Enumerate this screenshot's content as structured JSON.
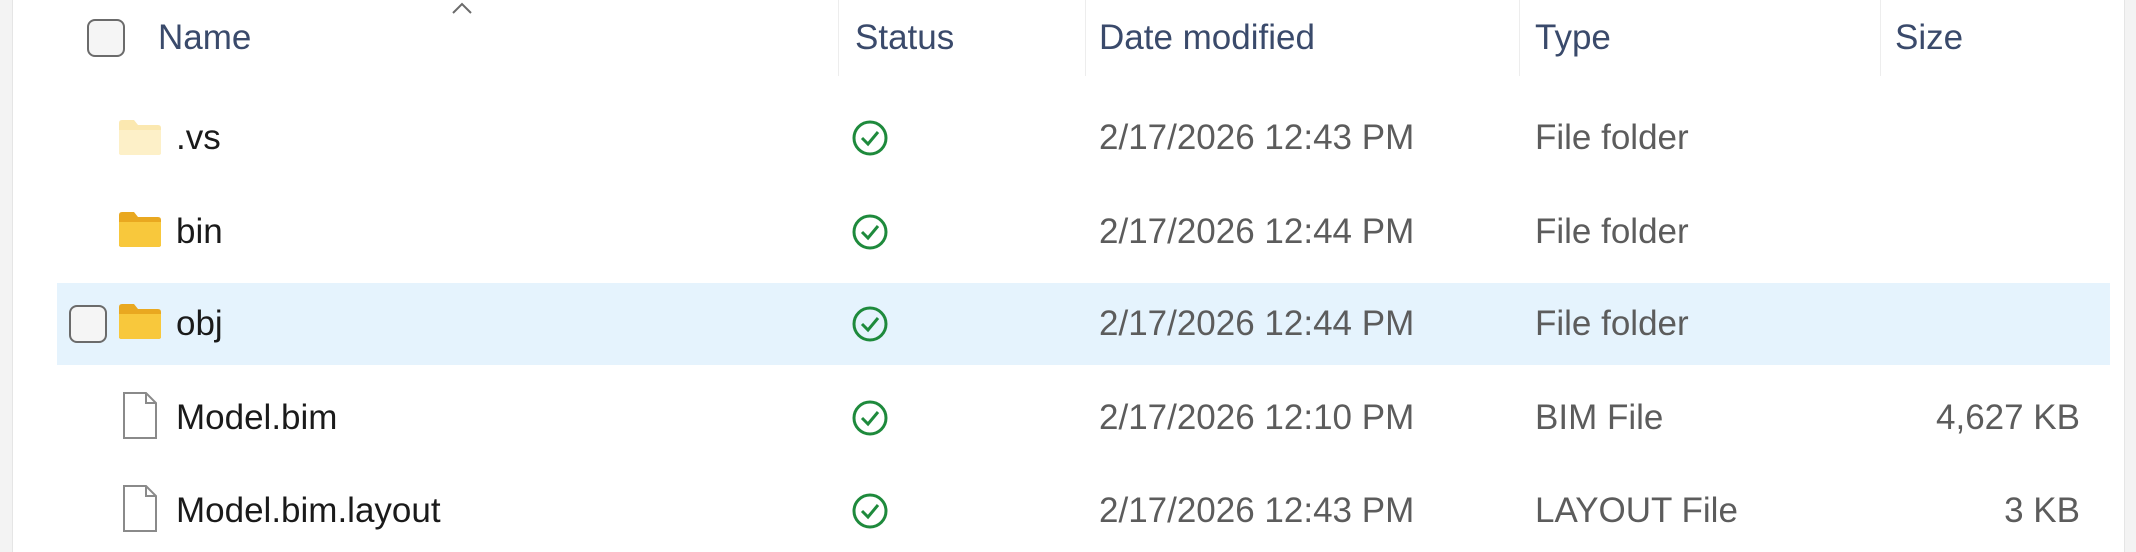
{
  "columns": {
    "name": "Name",
    "status": "Status",
    "date_modified": "Date modified",
    "type": "Type",
    "size": "Size"
  },
  "rows": [
    {
      "name": ".vs",
      "icon": "folder-icon-faded",
      "status": "synced",
      "date": "2/17/2026 12:43 PM",
      "type": "File folder",
      "size": ""
    },
    {
      "name": "bin",
      "icon": "folder-icon",
      "status": "synced",
      "date": "2/17/2026 12:44 PM",
      "type": "File folder",
      "size": ""
    },
    {
      "name": "obj",
      "icon": "folder-icon",
      "status": "synced",
      "date": "2/17/2026 12:44 PM",
      "type": "File folder",
      "size": "",
      "hovered": true
    },
    {
      "name": "Model.bim",
      "icon": "file-icon",
      "status": "synced",
      "date": "2/17/2026 12:10 PM",
      "type": "BIM File",
      "size": "4,627 KB"
    },
    {
      "name": "Model.bim.layout",
      "icon": "file-icon",
      "status": "synced",
      "date": "2/17/2026 12:43 PM",
      "type": "LAYOUT File",
      "size": "3 KB"
    }
  ],
  "colors": {
    "hover_row": "#e5f3fd",
    "status_green": "#1e8a3c",
    "folder_yellow": "#f8c83c",
    "header_text": "#3a4a6b"
  }
}
